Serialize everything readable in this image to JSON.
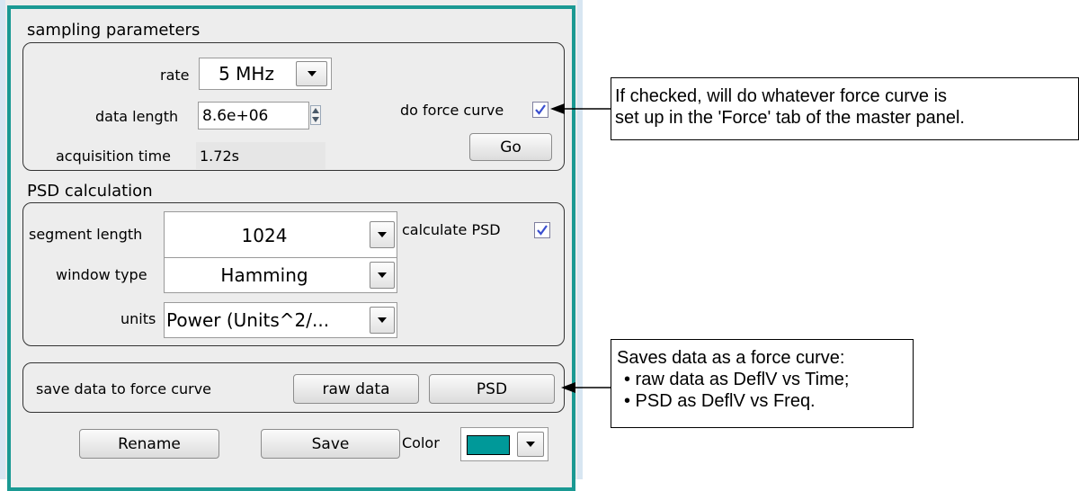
{
  "sampling": {
    "title": "sampling parameters",
    "rate_label": "rate",
    "rate_value": "5 MHz",
    "data_length_label": "data length",
    "data_length_value": "8.6e+06",
    "acq_time_label": "acquisition time",
    "acq_time_value": "1.72s",
    "force_curve_label": "do force curve",
    "force_curve_checked": true,
    "go_label": "Go"
  },
  "psd": {
    "title": "PSD calculation",
    "segment_label": "segment length",
    "segment_value": "1024",
    "calc_label": "calculate PSD",
    "calc_checked": true,
    "window_label": "window type",
    "window_value": "Hamming",
    "units_label": "units",
    "units_value": "Power (Units^2/..."
  },
  "save": {
    "label": "save data to force curve",
    "raw_label": "raw data",
    "psd_label": "PSD"
  },
  "bottom": {
    "rename_label": "Rename",
    "save_label": "Save",
    "color_label": "Color",
    "color_swatch": "#009999"
  },
  "annotations": {
    "force_curve_line1": "If checked, will do whatever force curve is",
    "force_curve_line2": "set up in the 'Force' tab of the master panel.",
    "save_line1": "Saves data as a force curve:",
    "save_line2": "• raw data as DeflV vs Time;",
    "save_line3": "• PSD as DeflV vs Freq."
  }
}
